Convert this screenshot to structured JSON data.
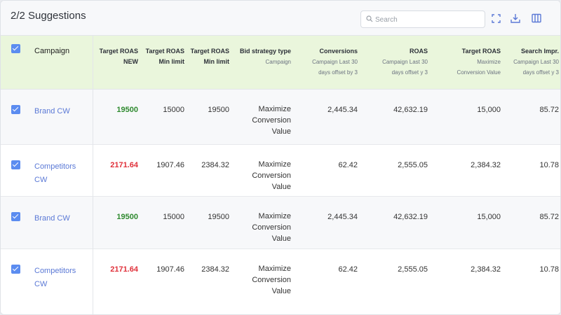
{
  "header": {
    "title": "2/2 Suggestions",
    "search_placeholder": "Search"
  },
  "columns": {
    "campaign": "Campaign",
    "target_roas_new": {
      "main": "Target ROAS",
      "sub": "NEW"
    },
    "target_roas_min": {
      "main": "Target ROAS",
      "sub": "Min limit"
    },
    "target_roas_max": {
      "main": "Target ROAS",
      "sub": "Min limit"
    },
    "bid_strategy": {
      "main": "Bid strategy type",
      "sub": "Campaign"
    },
    "conversions": {
      "main": "Conversions",
      "sub1": "Campaign Last 30",
      "sub2": "days offset by 3"
    },
    "roas": {
      "main": "ROAS",
      "sub1": "Campaign Last 30",
      "sub2": "days offset y 3"
    },
    "target_roas": {
      "main": "Target ROAS",
      "sub1": "Maximize",
      "sub2": "Conversion Value"
    },
    "search_impr": {
      "main": "Search Impr.",
      "sub1": "Campaign Last 30",
      "sub2": "days offset y 3"
    }
  },
  "rows": [
    {
      "campaign_line1": "Brand CW",
      "campaign_line2": "",
      "target_roas_new": "19500",
      "min_limit": "15000",
      "max_limit": "19500",
      "bid_line1": "Maximize",
      "bid_line2": "Conversion",
      "bid_line3": "Value",
      "conversions": "2,445.34",
      "roas": "42,632.19",
      "target_roas": "15,000",
      "search_impr": "85.72",
      "new_status": "increase"
    },
    {
      "campaign_line1": "Competitors",
      "campaign_line2": "CW",
      "target_roas_new": "2171.64",
      "min_limit": "1907.46",
      "max_limit": "2384.32",
      "bid_line1": "Maximize",
      "bid_line2": "Conversion",
      "bid_line3": "Value",
      "conversions": "62.42",
      "roas": "2,555.05",
      "target_roas": "2,384.32",
      "search_impr": "10.78",
      "new_status": "decrease"
    },
    {
      "campaign_line1": "Brand CW",
      "campaign_line2": "",
      "target_roas_new": "19500",
      "min_limit": "15000",
      "max_limit": "19500",
      "bid_line1": "Maximize",
      "bid_line2": "Conversion",
      "bid_line3": "Value",
      "conversions": "2,445.34",
      "roas": "42,632.19",
      "target_roas": "15,000",
      "search_impr": "85.72",
      "new_status": "increase"
    },
    {
      "campaign_line1": "Competitors",
      "campaign_line2": "CW",
      "target_roas_new": "2171.64",
      "min_limit": "1907.46",
      "max_limit": "2384.32",
      "bid_line1": "Maximize",
      "bid_line2": "Conversion",
      "bid_line3": "Value",
      "conversions": "62.42",
      "roas": "2,555.05",
      "target_roas": "2,384.32",
      "search_impr": "10.78",
      "new_status": "decrease"
    }
  ],
  "colors": {
    "header_bg": "#eaf6dc",
    "link": "#5b79d6",
    "checkbox": "#5b8cf0",
    "increase": "#2f8a2f",
    "decrease": "#e0303a"
  },
  "icons": [
    "search-icon",
    "fullscreen-icon",
    "download-icon",
    "columns-icon"
  ]
}
